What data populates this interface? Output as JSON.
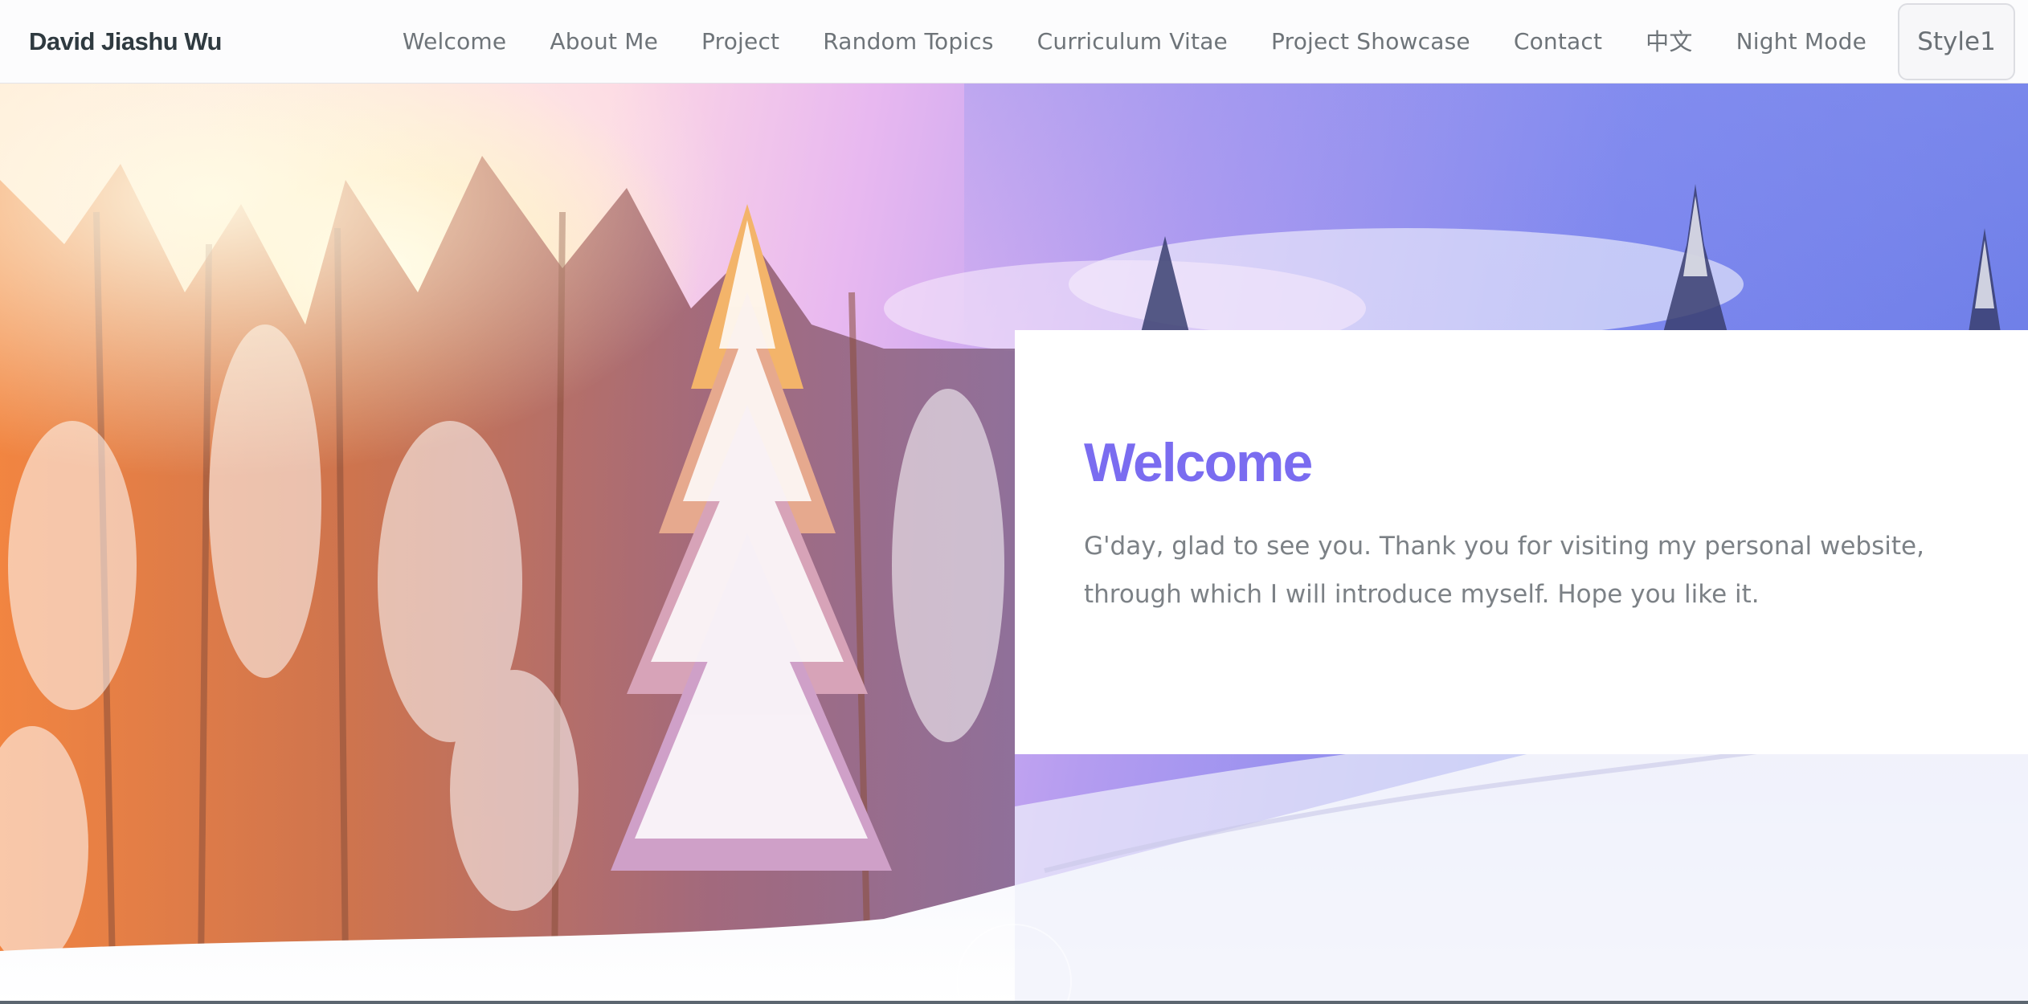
{
  "navbar": {
    "brand": "David Jiashu Wu",
    "items": [
      {
        "label": "Welcome"
      },
      {
        "label": "About Me"
      },
      {
        "label": "Project"
      },
      {
        "label": "Random Topics"
      },
      {
        "label": "Curriculum Vitae"
      },
      {
        "label": "Project Showcase"
      },
      {
        "label": "Contact"
      },
      {
        "label": "中文"
      },
      {
        "label": "Night Mode"
      }
    ],
    "style_button": "Style1"
  },
  "hero": {
    "background_icon": "snowy-forest-image",
    "welcome": {
      "title": "Welcome",
      "text": "G'day, glad to see you. Thank you for visiting my personal website, through which I will introduce myself. Hope you like it."
    }
  },
  "colors": {
    "accent": "#7a6cf0",
    "brand_text": "#2f3a40",
    "nav_text": "#6e7479",
    "body_text": "#7c8186"
  }
}
